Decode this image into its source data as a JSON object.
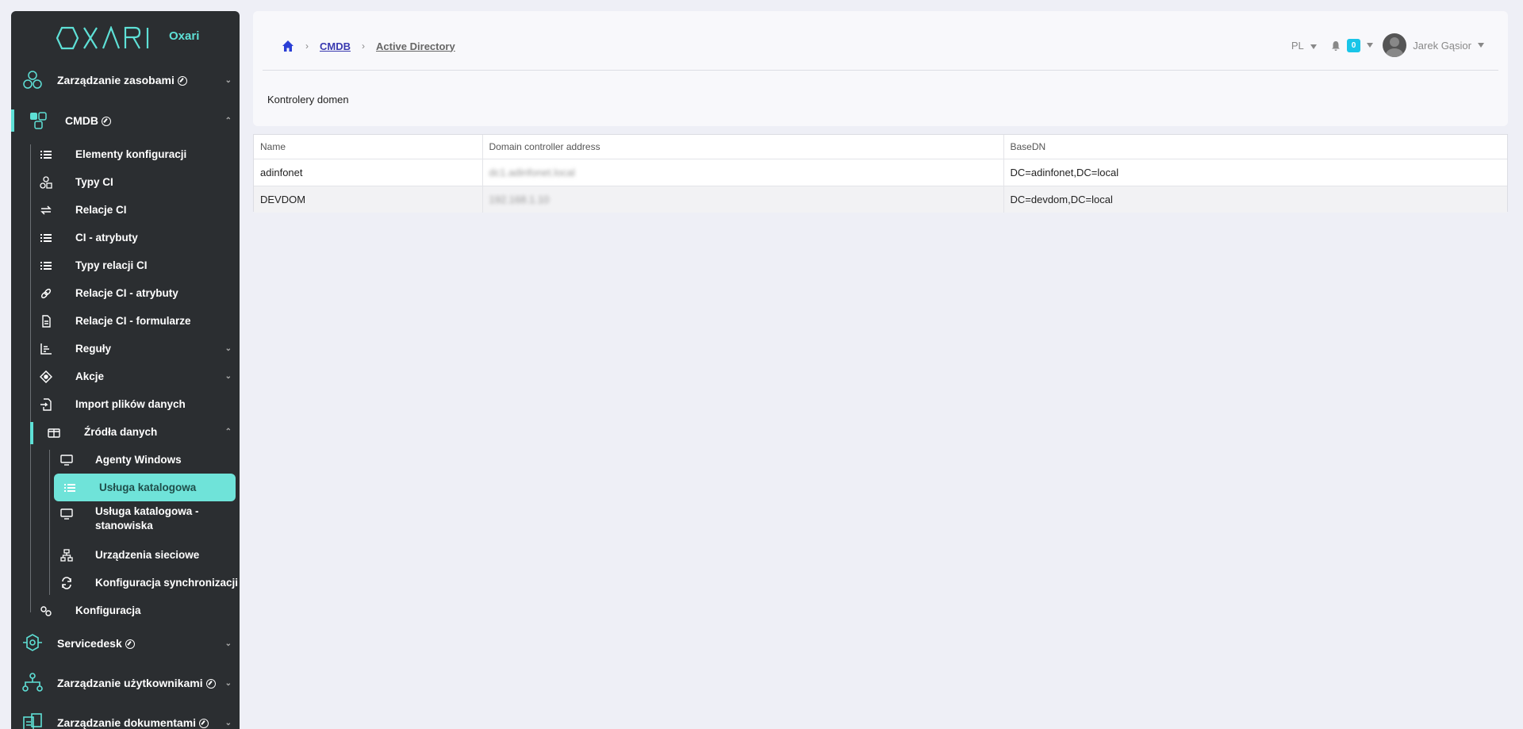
{
  "logo": {
    "name": "OXARI",
    "sub": "Oxari"
  },
  "sidebar": {
    "sections": [
      {
        "label": "Zarządzanie zasobami",
        "icon": "hexagon-cluster-icon"
      },
      {
        "label": "CMDB",
        "icon": "cubes-icon"
      },
      {
        "label": "Servicedesk",
        "icon": "headset-icon"
      },
      {
        "label": "Zarządzanie użytkownikami",
        "icon": "org-chart-icon"
      },
      {
        "label": "Zarządzanie dokumentami",
        "icon": "documents-icon"
      }
    ],
    "cmdb_items": [
      {
        "label": "Elementy konfiguracji",
        "icon": "list-icon"
      },
      {
        "label": "Typy CI",
        "icon": "shapes-icon"
      },
      {
        "label": "Relacje CI",
        "icon": "exchange-icon"
      },
      {
        "label": "CI - atrybuty",
        "icon": "list-icon"
      },
      {
        "label": "Typy relacji CI",
        "icon": "list-icon"
      },
      {
        "label": "Relacje CI - atrybuty",
        "icon": "link-icon"
      },
      {
        "label": "Relacje CI - formularze",
        "icon": "form-icon"
      },
      {
        "label": "Reguły",
        "icon": "chart-icon"
      },
      {
        "label": "Akcje",
        "icon": "target-icon"
      },
      {
        "label": "Import plików danych",
        "icon": "file-import-icon"
      },
      {
        "label": "Źródła danych",
        "icon": "box-icon"
      }
    ],
    "source_items": [
      {
        "label": "Agenty Windows",
        "icon": "monitor-icon"
      },
      {
        "label": "Usługa katalogowa",
        "icon": "list-icon"
      },
      {
        "label": "Usługa katalogowa - stanowiska",
        "icon": "monitor-icon"
      },
      {
        "label": "Urządzenia sieciowe",
        "icon": "network-icon"
      },
      {
        "label": "Konfiguracja synchronizacji",
        "icon": "sync-icon"
      }
    ],
    "config_item": {
      "label": "Konfiguracja",
      "icon": "gears-icon"
    }
  },
  "breadcrumb": {
    "items": [
      "CMDB",
      "Active Directory"
    ]
  },
  "header": {
    "lang": "PL",
    "notifications": "0",
    "user": "Jarek Gąsior"
  },
  "page": {
    "subtitle": "Kontrolery domen"
  },
  "table": {
    "columns": [
      "Name",
      "Domain controller address",
      "BaseDN"
    ],
    "rows": [
      {
        "name": "adinfonet",
        "address": "dc1.adinfonet.local",
        "basedn": "DC=adinfonet,DC=local"
      },
      {
        "name": "DEVDOM",
        "address": "192.168.1.10",
        "basedn": "DC=devdom,DC=local"
      }
    ]
  },
  "colors": {
    "accent": "#5ee0d6",
    "sidebar_bg": "#2b2e31",
    "badge": "#19c5e8",
    "link": "#3a3ab0"
  }
}
